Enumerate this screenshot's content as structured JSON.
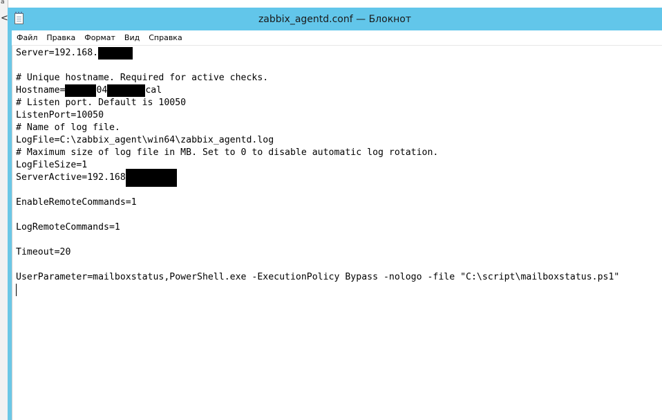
{
  "window": {
    "title": "zabbix_agentd.conf — Блокнот"
  },
  "left_strip": {
    "top_text": "a",
    "chevron": "<"
  },
  "menu": {
    "items": [
      "Файл",
      "Правка",
      "Формат",
      "Вид",
      "Справка"
    ]
  },
  "editor": {
    "line_server": "Server=192.168.",
    "line_blank1": "",
    "line_comment_hostname": "# Unique hostname. Required for active checks.",
    "hostname_prefix": "Hostname=",
    "hostname_mid": "04",
    "hostname_suffix": "cal",
    "line_comment_listen": "# Listen port. Default is 10050",
    "line_listenport": "ListenPort=10050",
    "line_comment_logname": "# Name of log file.",
    "line_logfile": "LogFile=C:\\zabbix_agent\\win64\\zabbix_agentd.log",
    "line_comment_logsize": "# Maximum size of log file in MB. Set to 0 to disable automatic log rotation.",
    "line_logfilesize": "LogFileSize=1",
    "line_serveractive": "ServerActive=192.168",
    "line_enableremote": "EnableRemoteCommands=1",
    "line_logremote": "LogRemoteCommands=1",
    "line_timeout": "Timeout=20",
    "line_userparam": "UserParameter=mailboxstatus,PowerShell.exe -ExecutionPolicy Bypass -nologo -file \"C:\\script\\mailboxstatus.ps1\""
  }
}
